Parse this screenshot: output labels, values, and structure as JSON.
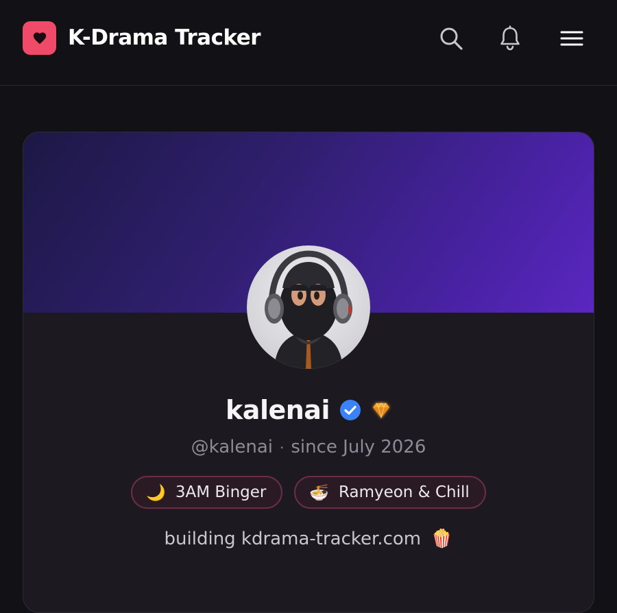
{
  "app": {
    "title": "K-Drama Tracker",
    "accent_color": "#f04a69",
    "logo_icon": "heart-icon"
  },
  "header": {
    "actions": [
      {
        "name": "search",
        "icon": "search-icon"
      },
      {
        "name": "notifications",
        "icon": "bell-icon"
      },
      {
        "name": "menu",
        "icon": "hamburger-menu-icon"
      }
    ]
  },
  "profile": {
    "username": "kalenai",
    "verified_icon": "verified-check-icon",
    "verified_color": "#3b82f6",
    "premium_icon": "diamond-icon",
    "handle": "@kalenai",
    "separator": "·",
    "member_since": "since July 2026",
    "banner_colors": [
      "#1d1845",
      "#5a27c0"
    ],
    "tags": [
      {
        "emoji": "🌙",
        "label": "3AM Binger"
      },
      {
        "emoji": "🍜",
        "label": "Ramyeon & Chill"
      }
    ],
    "bio": {
      "text": "building kdrama-tracker.com",
      "emoji": "🍿"
    }
  }
}
